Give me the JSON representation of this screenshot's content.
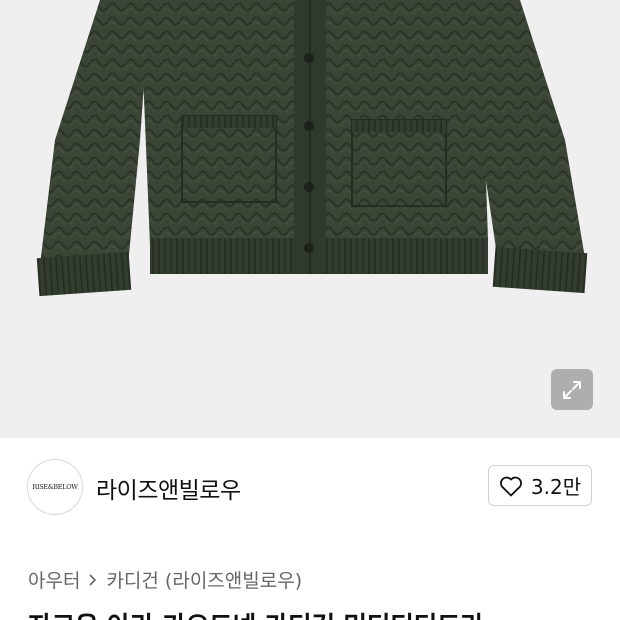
{
  "product_image": {
    "alt": "",
    "colors": {
      "background": "#efefef",
      "knit": "#3a4536",
      "knit_shadow": "#252d23",
      "button": "#1c211a"
    }
  },
  "expand_button": {
    "icon": "expand-arrows-icon"
  },
  "brand": {
    "logo_text": "RISE&BELOW",
    "name": "라이즈앤빌로우"
  },
  "like": {
    "icon": "heart-outline-icon",
    "count": "3.2만"
  },
  "breadcrumb": {
    "items": [
      "아우터",
      "카디건 (라이즈앤빌로우)"
    ],
    "separator_icon": "chevron-right-icon"
  },
  "product": {
    "title_partial": "자크우 아라 가오드넨 카디건 민디디디드라"
  }
}
